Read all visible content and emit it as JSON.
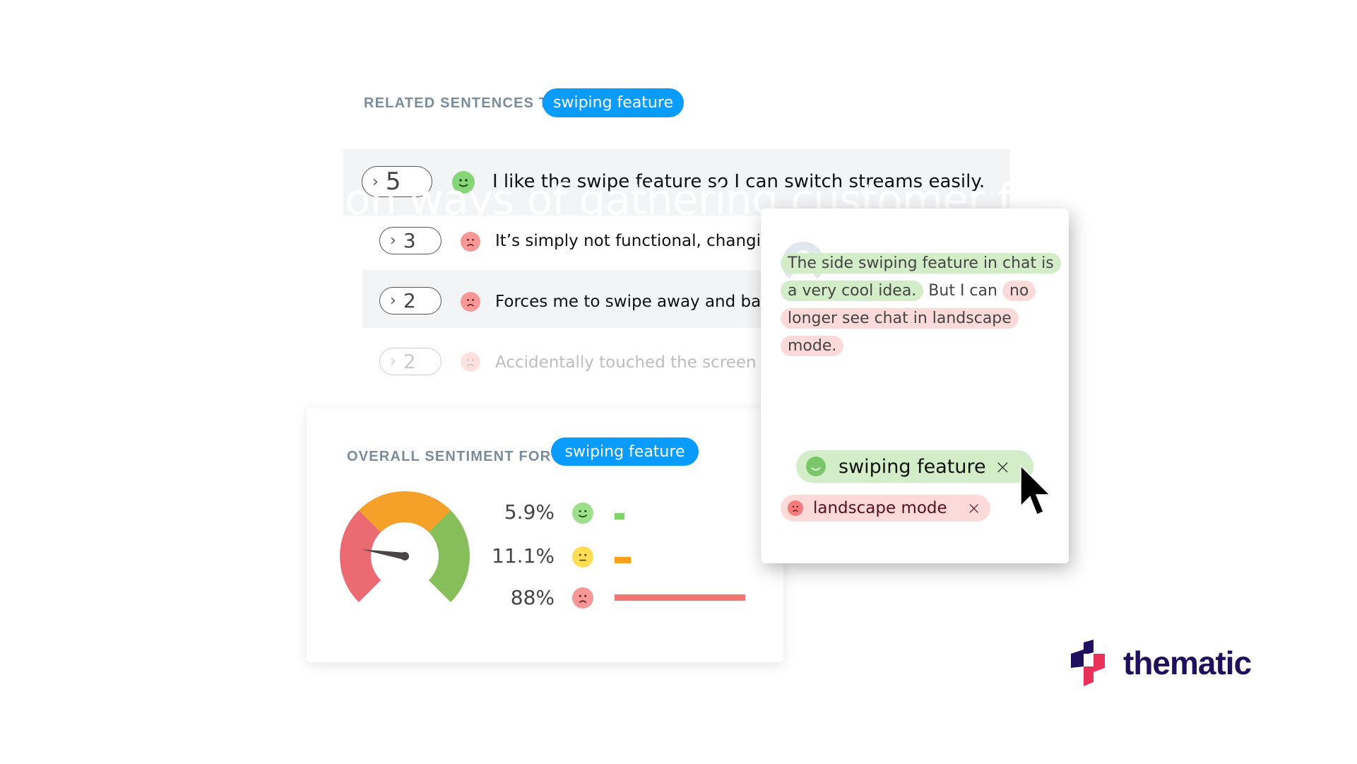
{
  "related": {
    "label": "RELATED SENTENCES TO",
    "theme": "swiping feature",
    "rows": [
      {
        "count": "5",
        "sentiment": "positive",
        "text": "I like the swipe feature so I can switch streams easily."
      },
      {
        "count": "3",
        "sentiment": "negative",
        "text": "It’s simply not functional, changing"
      },
      {
        "count": "2",
        "sentiment": "negative",
        "text": "Forces me to swipe away and back"
      },
      {
        "count": "2",
        "sentiment": "negative",
        "text": "Accidentally  touched the screen an"
      }
    ]
  },
  "watermark": "on ways of gathering customer feedb",
  "sentiment": {
    "label": "OVERALL SENTIMENT FOR",
    "theme": "swiping feature",
    "gauge_needle_fraction": 0.2,
    "rows": [
      {
        "pct": "5.9%",
        "value": 5.9,
        "sentiment": "positive",
        "color": "#7fd36b"
      },
      {
        "pct": "11.1%",
        "value": 11.1,
        "sentiment": "neutral",
        "color": "#ff9f1c"
      },
      {
        "pct": "88%",
        "value": 88,
        "sentiment": "negative",
        "color": "#f47373"
      }
    ],
    "gauge_colors": {
      "negative": "#ec6b73",
      "neutral": "#f5a028",
      "positive": "#86bf59"
    }
  },
  "comment": {
    "segments": [
      {
        "text": "The side swiping feature in chat is a very cool idea.",
        "highlight": "positive"
      },
      {
        "text": " But I can ",
        "highlight": "none"
      },
      {
        "text": "no longer see chat in landscape mode.",
        "highlight": "negative"
      }
    ],
    "tags": [
      {
        "label": "swiping feature",
        "sentiment": "positive",
        "remove": "×"
      },
      {
        "label": "landscape mode",
        "sentiment": "negative",
        "remove": "×"
      }
    ]
  },
  "brand": {
    "name": "thematic",
    "color_primary": "#1f0f5c",
    "color_accent": "#e8325a"
  },
  "colors": {
    "accent_blue": "#0a9bff",
    "label_gray": "#7a8b9c"
  }
}
